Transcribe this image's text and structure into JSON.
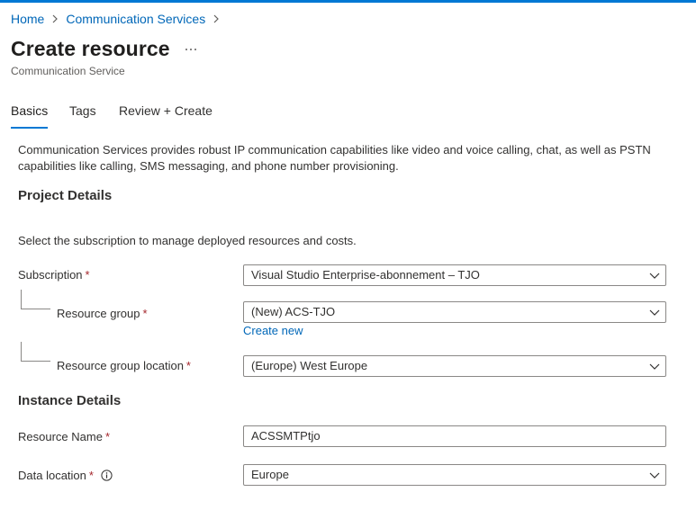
{
  "breadcrumb": {
    "items": [
      "Home",
      "Communication Services"
    ]
  },
  "header": {
    "title": "Create resource",
    "subtitle": "Communication Service",
    "more_label": "..."
  },
  "tabs": [
    {
      "label": "Basics",
      "active": true
    },
    {
      "label": "Tags"
    },
    {
      "label": "Review + Create"
    }
  ],
  "intro": "Communication Services provides robust IP communication capabilities like video and voice calling, chat, as well as PSTN capabilities like calling, SMS messaging, and phone number provisioning.",
  "project": {
    "heading": "Project Details",
    "description": "Select the subscription to manage deployed resources and costs.",
    "subscription": {
      "label": "Subscription",
      "value": "Visual Studio Enterprise-abonnement – TJO"
    },
    "resource_group": {
      "label": "Resource group",
      "value": "(New) ACS-TJO",
      "create_new": "Create new"
    },
    "resource_group_location": {
      "label": "Resource group location",
      "value": "(Europe) West Europe"
    }
  },
  "instance": {
    "heading": "Instance Details",
    "resource_name": {
      "label": "Resource Name",
      "value": "ACSSMTPtjo"
    },
    "data_location": {
      "label": "Data location",
      "value": "Europe"
    }
  },
  "required_marker": "*",
  "colors": {
    "accent": "#0078d4",
    "link": "#0067b8",
    "required": "#a4262c",
    "border": "#8a8886",
    "text": "#323130"
  },
  "icons": [
    "chevron-right-icon",
    "more-icon",
    "chevron-down-icon",
    "info-icon"
  ]
}
